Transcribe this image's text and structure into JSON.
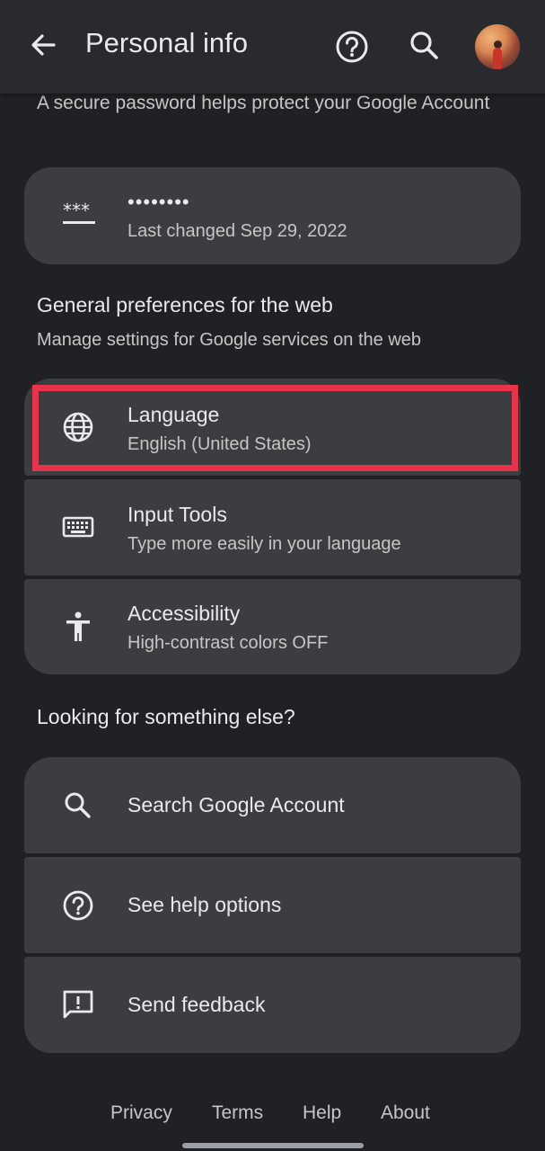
{
  "header": {
    "title": "Personal info"
  },
  "password_section": {
    "intro": "A secure password helps protect your Google Account",
    "masked_value": "••••••••",
    "last_changed": "Last changed Sep 29, 2022"
  },
  "preferences": {
    "title": "General preferences for the web",
    "subtitle": "Manage settings for Google services on the web",
    "items": [
      {
        "label": "Language",
        "value": "English (United States)",
        "icon": "globe-icon"
      },
      {
        "label": "Input Tools",
        "value": "Type more easily in your language",
        "icon": "keyboard-icon"
      },
      {
        "label": "Accessibility",
        "value": "High-contrast colors OFF",
        "icon": "accessibility-icon"
      }
    ]
  },
  "more": {
    "title": "Looking for something else?",
    "items": [
      {
        "label": "Search Google Account",
        "icon": "search-icon"
      },
      {
        "label": "See help options",
        "icon": "help-circle-icon"
      },
      {
        "label": "Send feedback",
        "icon": "feedback-icon"
      }
    ]
  },
  "footer": {
    "links": [
      "Privacy",
      "Terms",
      "Help",
      "About"
    ]
  },
  "colors": {
    "background": "#202124",
    "card": "#3c3d40",
    "highlight": "#e8344b"
  }
}
